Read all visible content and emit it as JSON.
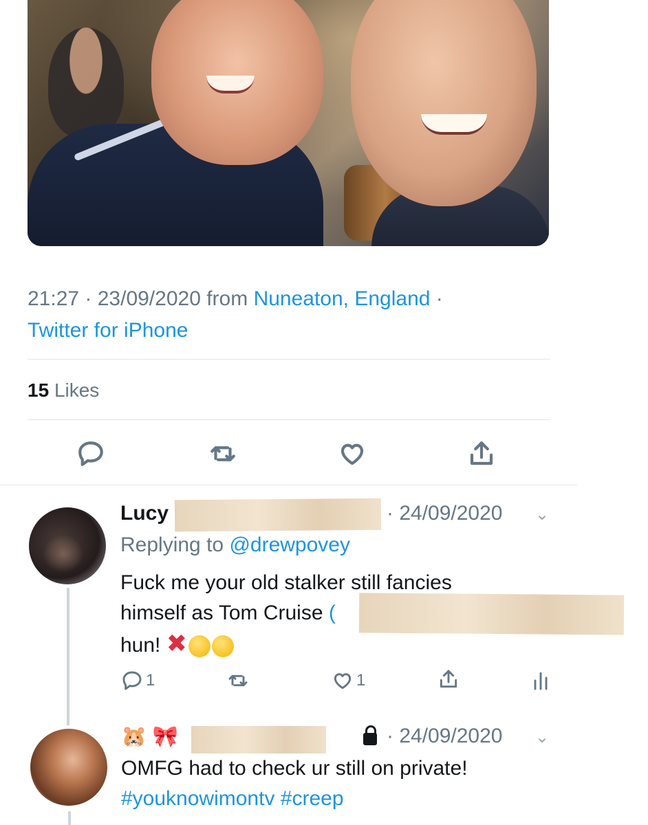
{
  "tweet": {
    "timestamp": "21:27 · 23/09/2020 from",
    "location": "Nuneaton, England",
    "location_sep": " ·",
    "client": "Twitter for iPhone",
    "likes_count": "15",
    "likes_label": "Likes",
    "actions": [
      "reply-icon",
      "retweet-icon",
      "like-icon",
      "share-icon"
    ]
  },
  "replies": [
    {
      "name": "Lucy",
      "date": "· 24/09/2020",
      "replying_prefix": "Replying to",
      "replying_handle": "@drewpovey",
      "text_line1": "Fuck me your old stalker still fancies",
      "text_line2": "himself as Tom Cruise",
      "text_line3": "hun!",
      "reply_count": "1",
      "like_count": "1"
    },
    {
      "name_emojis": "hamster-bow-emojis",
      "date": "· 24/09/2020",
      "text_line1": "OMFG had to check ur still on private!",
      "hashtags": "#youknowimontv #creep"
    }
  ],
  "colors": {
    "link": "#1b95e0",
    "muted": "#657786",
    "separator": "#e1e8ed"
  }
}
